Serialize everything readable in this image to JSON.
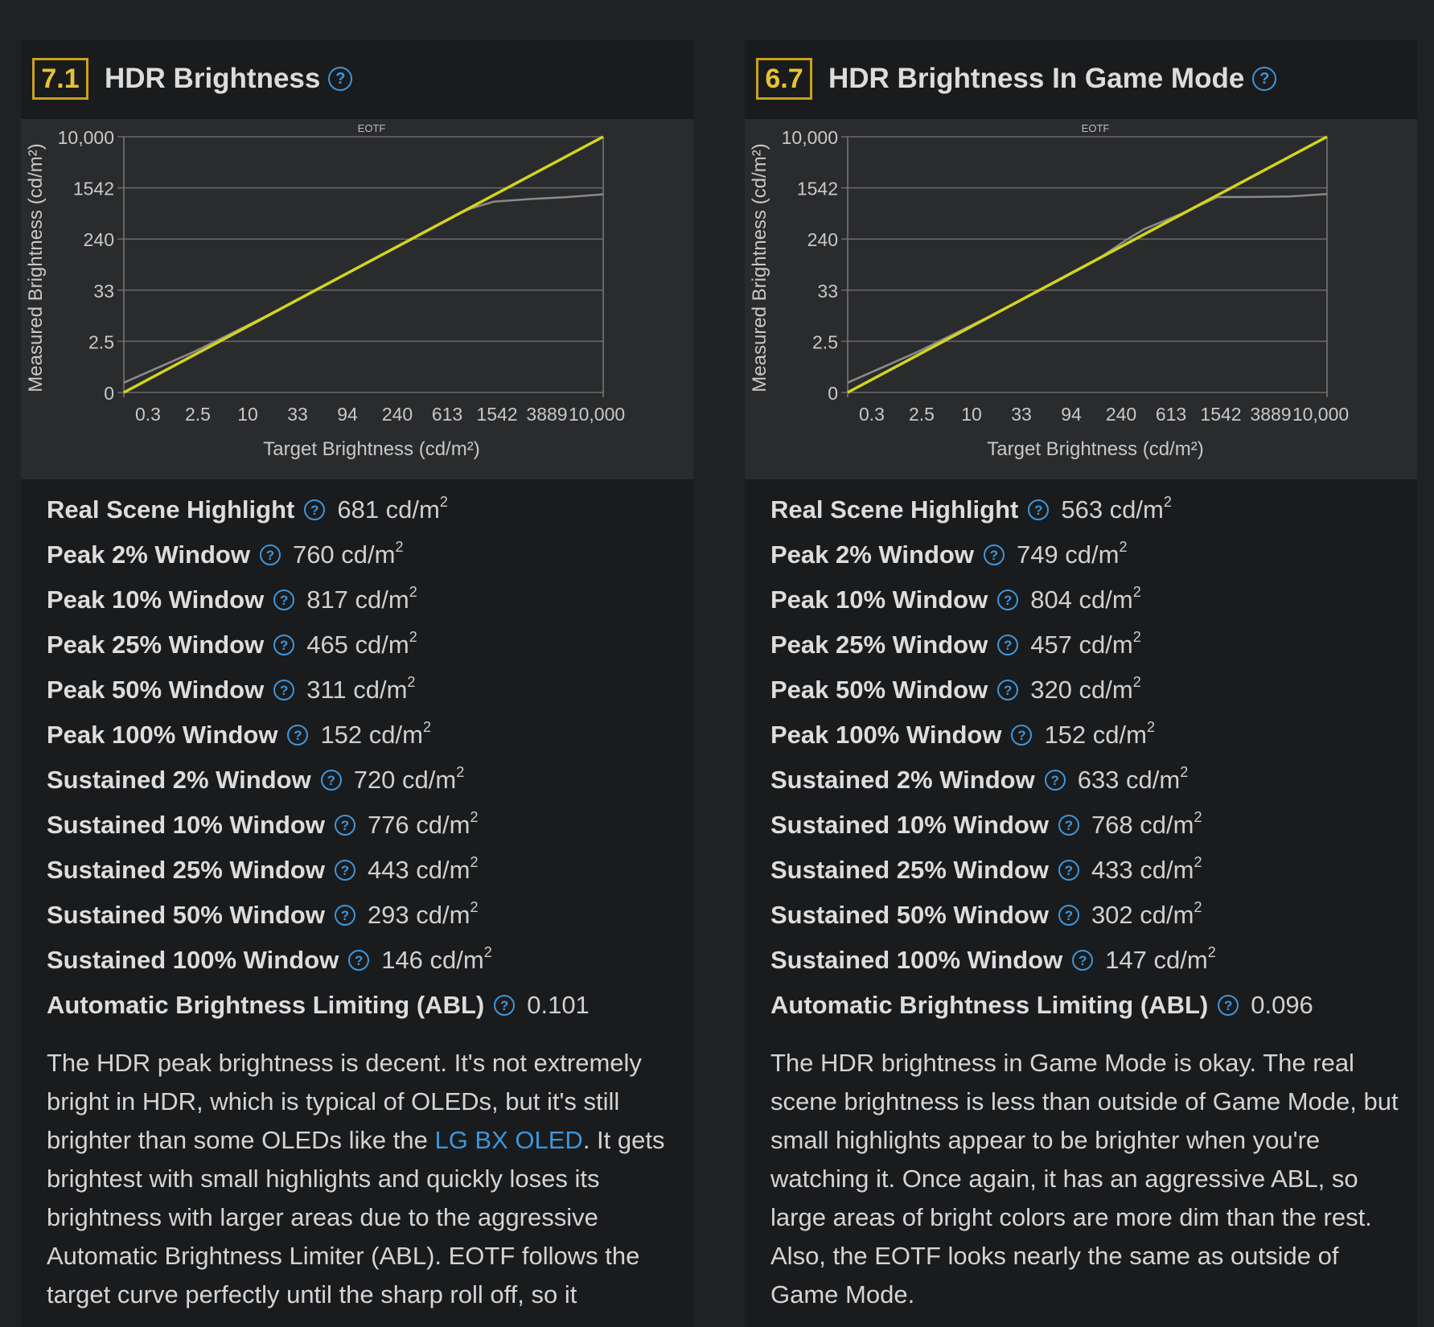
{
  "colors": {
    "background": "#1f2225",
    "panel": "#1a1b1d",
    "chart_background": "#2a2b2d",
    "score_border": "#c9a31f",
    "help_icon": "#3d96db",
    "link": "#3d96db",
    "target_curve": "#d4d41e",
    "measured_curve": "#8a8a8a"
  },
  "panels": [
    {
      "score": "7.1",
      "title": "HDR Brightness",
      "help_icon": "question-circle-icon",
      "metrics": [
        {
          "label": "Real Scene Highlight",
          "value": "681 cd/m",
          "sup": "2"
        },
        {
          "label": "Peak 2% Window",
          "value": "760 cd/m",
          "sup": "2"
        },
        {
          "label": "Peak 10% Window",
          "value": "817 cd/m",
          "sup": "2"
        },
        {
          "label": "Peak 25% Window",
          "value": "465 cd/m",
          "sup": "2"
        },
        {
          "label": "Peak 50% Window",
          "value": "311 cd/m",
          "sup": "2"
        },
        {
          "label": "Peak 100% Window",
          "value": "152 cd/m",
          "sup": "2"
        },
        {
          "label": "Sustained 2% Window",
          "value": "720 cd/m",
          "sup": "2"
        },
        {
          "label": "Sustained 10% Window",
          "value": "776 cd/m",
          "sup": "2"
        },
        {
          "label": "Sustained 25% Window",
          "value": "443 cd/m",
          "sup": "2"
        },
        {
          "label": "Sustained 50% Window",
          "value": "293 cd/m",
          "sup": "2"
        },
        {
          "label": "Sustained 100% Window",
          "value": "146 cd/m",
          "sup": "2"
        },
        {
          "label": "Automatic Brightness Limiting (ABL)",
          "value": "0.101",
          "sup": ""
        }
      ],
      "description": {
        "before_link": "The HDR peak brightness is decent. It's not extremely bright in HDR, which is typical of OLEDs, but it's still brighter than some OLEDs like the ",
        "link": "LG BX OLED",
        "after_link": ". It gets brightest with small highlights and quickly loses its brightness with larger areas due to the aggressive Automatic Brightness Limiter (ABL). EOTF follows the target curve perfectly until the sharp roll off, so it"
      }
    },
    {
      "score": "6.7",
      "title": "HDR Brightness In Game Mode",
      "help_icon": "question-circle-icon",
      "metrics": [
        {
          "label": "Real Scene Highlight",
          "value": "563 cd/m",
          "sup": "2"
        },
        {
          "label": "Peak 2% Window",
          "value": "749 cd/m",
          "sup": "2"
        },
        {
          "label": "Peak 10% Window",
          "value": "804 cd/m",
          "sup": "2"
        },
        {
          "label": "Peak 25% Window",
          "value": "457 cd/m",
          "sup": "2"
        },
        {
          "label": "Peak 50% Window",
          "value": "320 cd/m",
          "sup": "2"
        },
        {
          "label": "Peak 100% Window",
          "value": "152 cd/m",
          "sup": "2"
        },
        {
          "label": "Sustained 2% Window",
          "value": "633 cd/m",
          "sup": "2"
        },
        {
          "label": "Sustained 10% Window",
          "value": "768 cd/m",
          "sup": "2"
        },
        {
          "label": "Sustained 25% Window",
          "value": "433 cd/m",
          "sup": "2"
        },
        {
          "label": "Sustained 50% Window",
          "value": "302 cd/m",
          "sup": "2"
        },
        {
          "label": "Sustained 100% Window",
          "value": "147 cd/m",
          "sup": "2"
        },
        {
          "label": "Automatic Brightness Limiting (ABL)",
          "value": "0.096",
          "sup": ""
        }
      ],
      "description": {
        "before_link": "The HDR brightness in Game Mode is okay. The real scene brightness is less than outside of Game Mode, but small highlights appear to be brighter when you're watching it. Once again, it has an aggressive ABL, so large areas of bright colors are more dim than the rest. Also, the EOTF looks nearly the same as outside of Game Mode.",
        "link": "",
        "after_link": ""
      }
    }
  ],
  "chart_data": [
    {
      "type": "line",
      "title": "EOTF",
      "xlabel": "Target Brightness (cd/m²)",
      "ylabel": "Measured Brightness (cd/m²)",
      "x_ticks": [
        "0.3",
        "2.5",
        "10",
        "33",
        "94",
        "240",
        "613",
        "1542",
        "3889",
        "10,000"
      ],
      "y_ticks": [
        "0",
        "2.5",
        "33",
        "240",
        "1542",
        "10,000"
      ],
      "grid": true,
      "series": [
        {
          "role": "target",
          "x": [
            0.05,
            10000
          ],
          "y": [
            0.05,
            10000
          ]
        },
        {
          "role": "measured",
          "x": [
            0.05,
            0.3,
            2.5,
            10,
            33,
            94,
            240,
            350,
            613,
            1542,
            3889,
            10000
          ],
          "y": [
            0.08,
            0.35,
            2.5,
            10,
            33,
            94,
            240,
            330,
            450,
            510,
            560,
            640
          ]
        }
      ]
    },
    {
      "type": "line",
      "title": "EOTF",
      "xlabel": "Target Brightness (cd/m²)",
      "ylabel": "Measured Brightness (cd/m²)",
      "x_ticks": [
        "0.3",
        "2.5",
        "10",
        "33",
        "94",
        "240",
        "613",
        "1542",
        "3889",
        "10,000"
      ],
      "y_ticks": [
        "0",
        "2.5",
        "33",
        "240",
        "1542",
        "10,000"
      ],
      "grid": true,
      "series": [
        {
          "role": "target",
          "x": [
            0.05,
            10000
          ],
          "y": [
            0.05,
            10000
          ]
        },
        {
          "role": "measured",
          "x": [
            0.05,
            0.3,
            2.5,
            10,
            33,
            60,
            94,
            240,
            613,
            1542,
            3889,
            10000
          ],
          "y": [
            0.08,
            0.35,
            2.5,
            10,
            34,
            72,
            120,
            250,
            560,
            565,
            580,
            650
          ]
        }
      ]
    }
  ]
}
